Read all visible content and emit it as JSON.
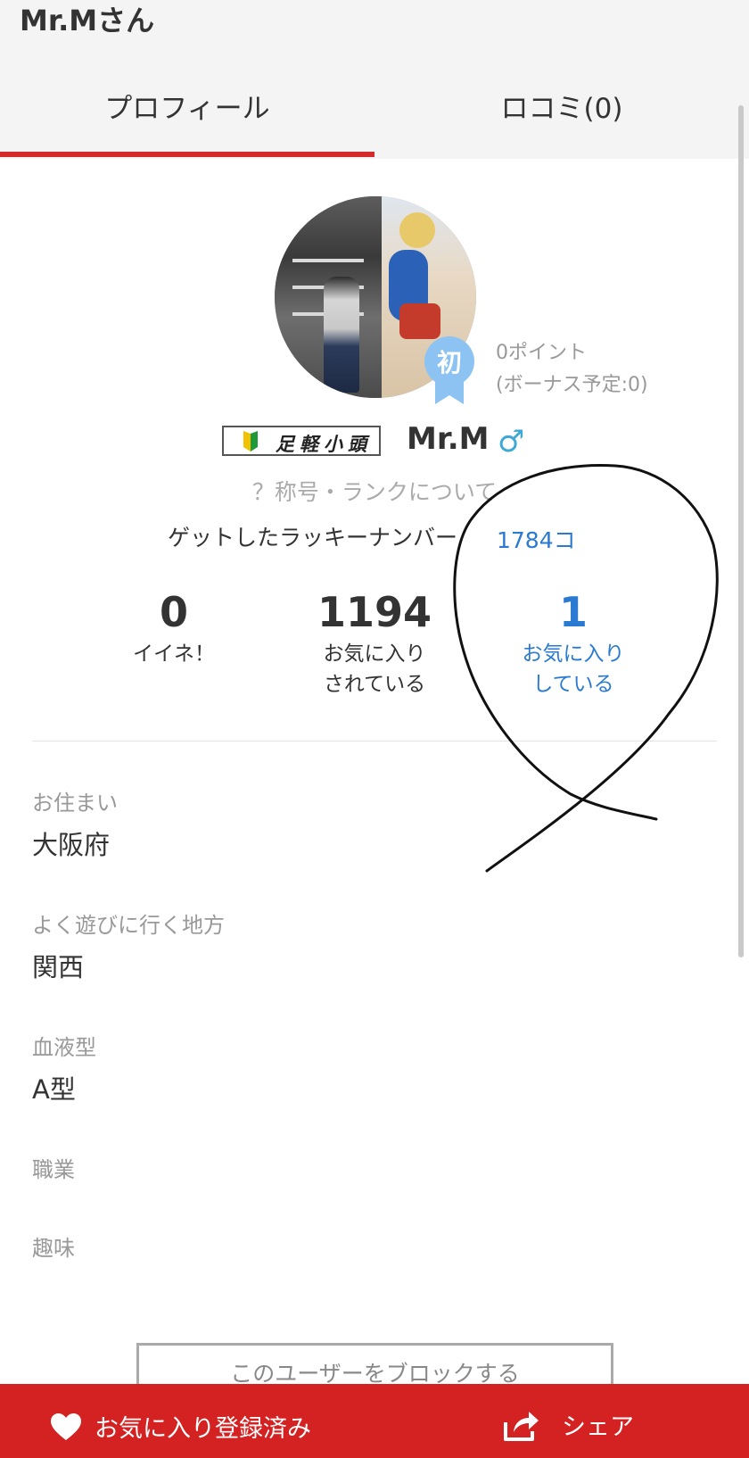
{
  "header": {
    "title": "Mr.Mさん",
    "tabs": [
      {
        "label": "プロフィール",
        "active": true
      },
      {
        "label": "ロコミ(0)",
        "active": false
      }
    ]
  },
  "profile": {
    "rank_badge_char": "初",
    "points": "0ポイント",
    "bonus": "(ボーナス予定:0)",
    "title_badge": "足軽小頭",
    "username": "Mr.M",
    "gender_icon": "male-icon",
    "rank_help": "？称号・ランクについて",
    "lucky_label": "ゲットしたラッキーナンバー",
    "lucky_value": "1784コ"
  },
  "stats": {
    "likes": {
      "value": "0",
      "label": "イイネ！"
    },
    "favorited_by": {
      "value": "1194",
      "label": "お気に入り\nされている"
    },
    "favoriting": {
      "value": "1",
      "label": "お気に入り\nしている"
    }
  },
  "fields": [
    {
      "label": "お住まい",
      "value": "大阪府"
    },
    {
      "label": "よく遊びに行く地方",
      "value": "関西"
    },
    {
      "label": "血液型",
      "value": "A型"
    },
    {
      "label": "職業",
      "value": ""
    },
    {
      "label": "趣味",
      "value": ""
    }
  ],
  "block_button": "このユーザーをブロックする",
  "bottom_bar": {
    "favorite_label": "お気に入り登録済み",
    "share_label": "シェア"
  },
  "colors": {
    "accent_red": "#d42121",
    "link_blue": "#2a7ad1",
    "badge_blue": "#8cc3f2",
    "gender_blue": "#3fa9d6"
  }
}
